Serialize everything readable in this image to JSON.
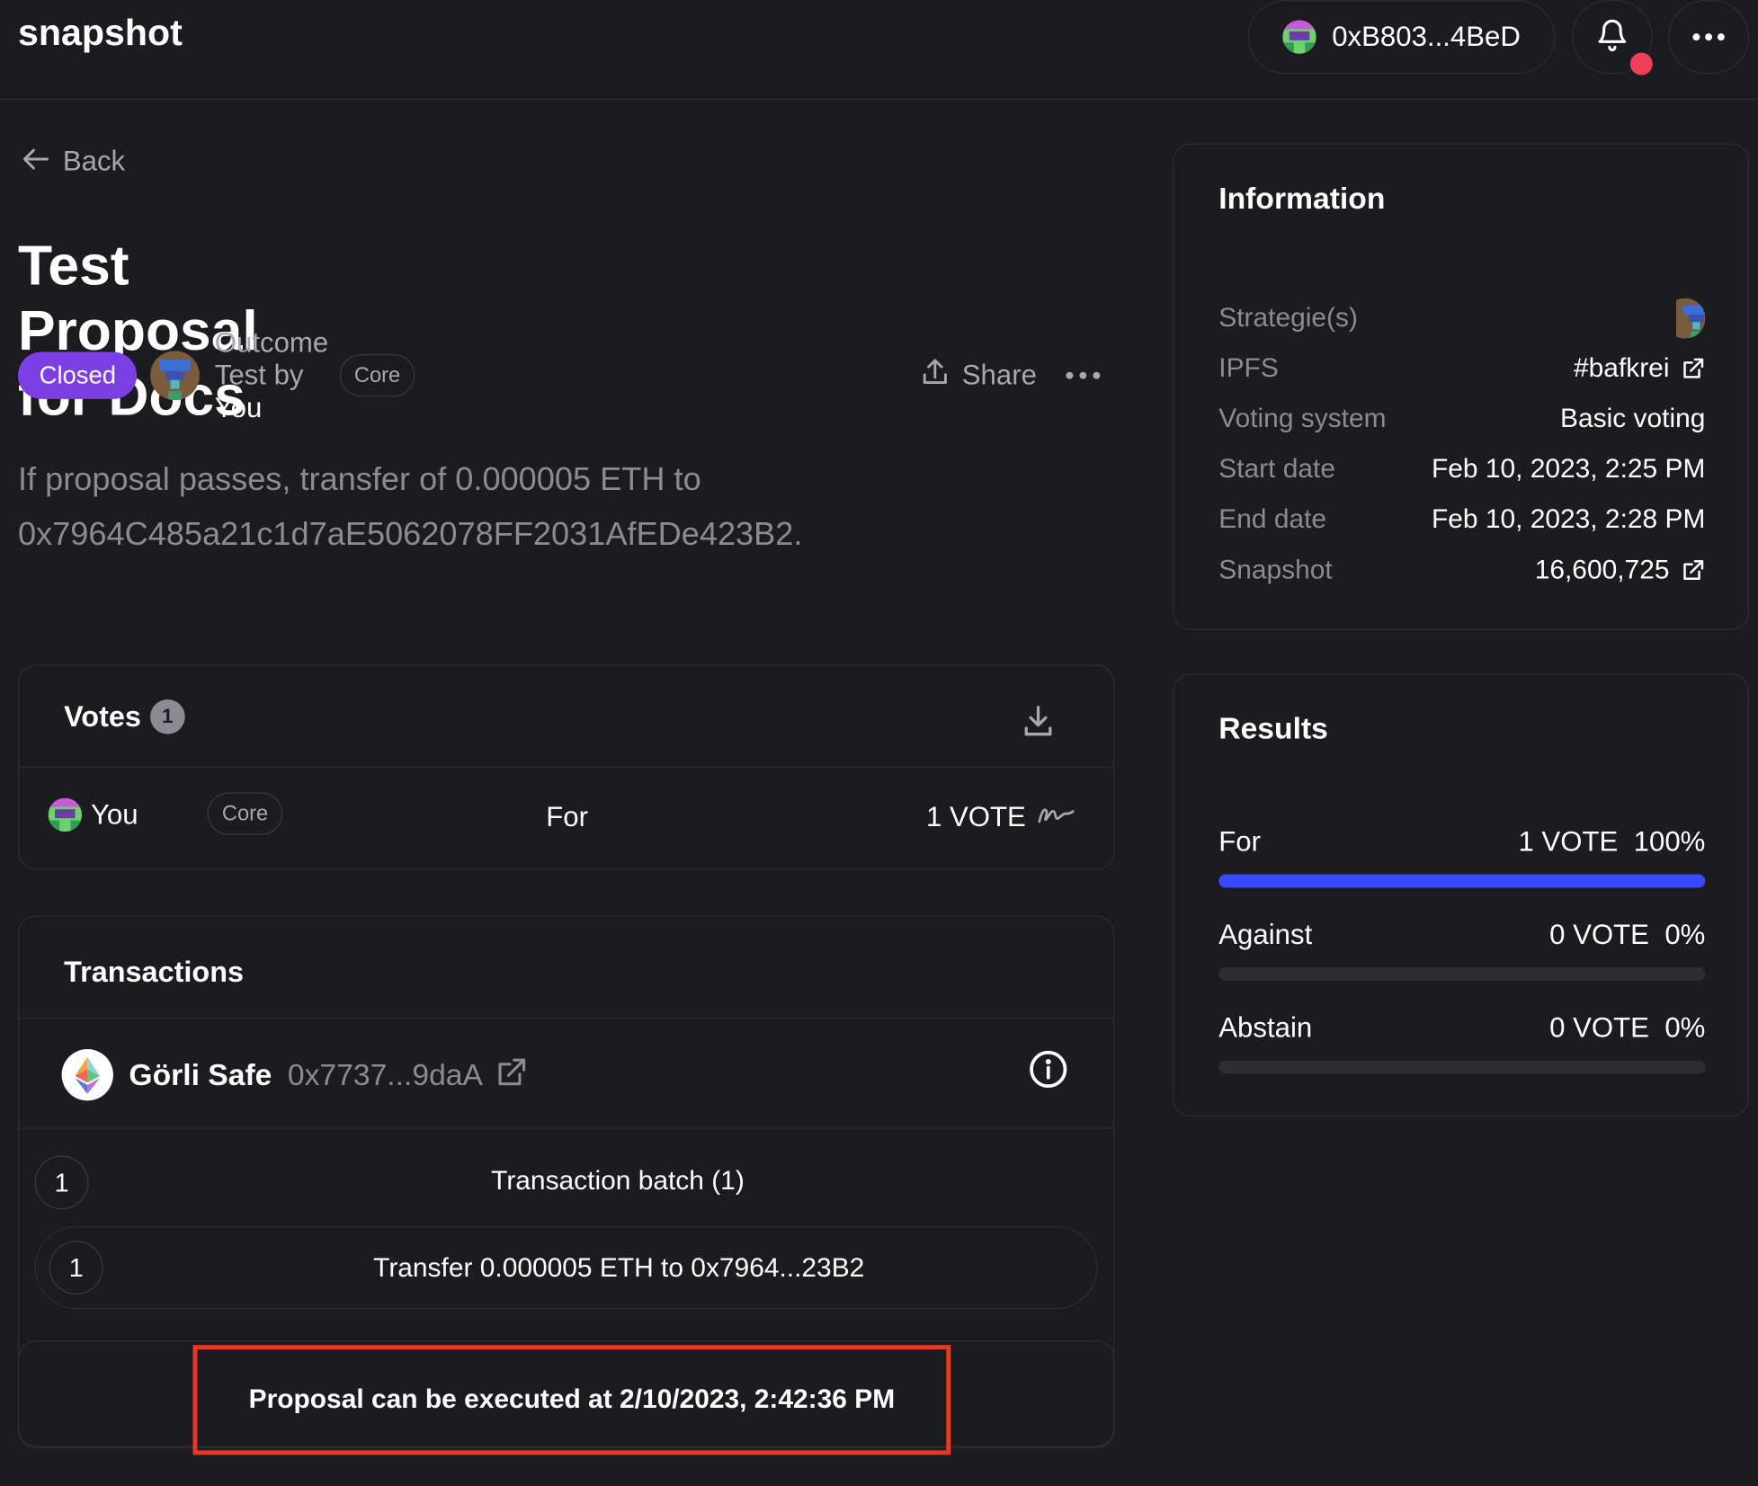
{
  "header": {
    "logo": "snapshot",
    "wallet_address": "0xB803...4BeD",
    "notification_icon": "bell-icon",
    "menu_icon": "more-horizontal-icon"
  },
  "nav": {
    "back_label": "Back",
    "back_icon": "arrow-left-icon"
  },
  "proposal": {
    "title": "Test Proposal for Docs",
    "status": "Closed",
    "space": "Outcome Test",
    "by": "by",
    "author": "You",
    "author_badge": "Core",
    "share_label": "Share",
    "body": "If proposal passes, transfer of 0.000005 ETH to 0x7964C485a21c1d7aE5062078FF2031AfEDe423B2."
  },
  "votes": {
    "heading": "Votes",
    "count": "1",
    "rows": [
      {
        "voter": "You",
        "badge": "Core",
        "choice": "For",
        "power": "1 VOTE"
      }
    ]
  },
  "transactions": {
    "heading": "Transactions",
    "safe_name": "Görli Safe",
    "safe_address": "0x7737...9daA",
    "batch_number": "1",
    "batch_label": "Transaction batch (1)",
    "items": [
      {
        "number": "1",
        "label": "Transfer 0.000005 ETH to 0x7964...23B2"
      }
    ],
    "execution_notice": "Proposal can be executed at 2/10/2023, 2:42:36 PM"
  },
  "information": {
    "heading": "Information",
    "rows": [
      {
        "key": "Strategie(s)",
        "value": ""
      },
      {
        "key": "IPFS",
        "value": "#bafkrei"
      },
      {
        "key": "Voting system",
        "value": "Basic voting"
      },
      {
        "key": "Start date",
        "value": "Feb 10, 2023, 2:25 PM"
      },
      {
        "key": "End date",
        "value": "Feb 10, 2023, 2:28 PM"
      },
      {
        "key": "Snapshot",
        "value": "16,600,725"
      }
    ]
  },
  "results": {
    "heading": "Results",
    "choices": [
      {
        "label": "For",
        "votes": "1 VOTE",
        "percent": "100%",
        "fraction": 1.0
      },
      {
        "label": "Against",
        "votes": "0 VOTE",
        "percent": "0%",
        "fraction": 0.0
      },
      {
        "label": "Abstain",
        "votes": "0 VOTE",
        "percent": "0%",
        "fraction": 0.0
      }
    ]
  },
  "colors": {
    "background": "#1c1b20",
    "border": "#2e2d33",
    "closed_badge": "#7b3fe4",
    "result_bar": "#384aff",
    "notification_dot": "#f03f5b",
    "highlight_box": "#e53a24"
  }
}
